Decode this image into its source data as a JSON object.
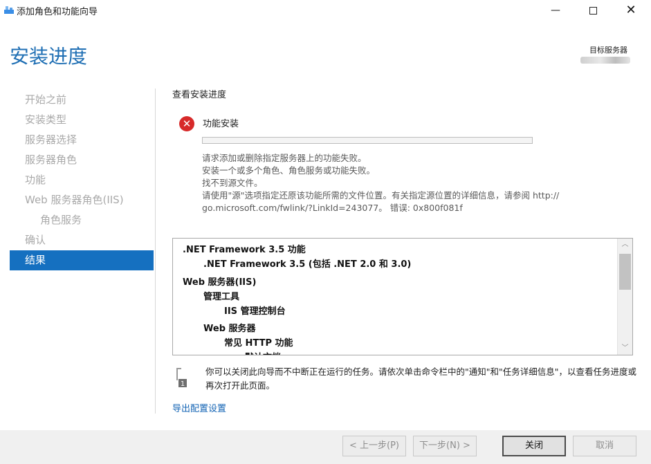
{
  "window": {
    "title": "添加角色和功能向导",
    "minimize_glyph": "—",
    "close_glyph": "✕"
  },
  "header": {
    "heading": "安装进度",
    "destination_label": "目标服务器"
  },
  "nav": {
    "items": [
      {
        "label": "开始之前"
      },
      {
        "label": "安装类型"
      },
      {
        "label": "服务器选择"
      },
      {
        "label": "服务器角色"
      },
      {
        "label": "功能"
      },
      {
        "label": "Web 服务器角色(IIS)"
      },
      {
        "label": "角色服务"
      },
      {
        "label": "确认"
      },
      {
        "label": "结果"
      }
    ],
    "active_index": 8
  },
  "main": {
    "section_title": "查看安装进度",
    "feature_name": "功能安装",
    "progress_percent": 0,
    "messages": [
      "请求添加或删除指定服务器上的功能失败。",
      "安装一个或多个角色、角色服务或功能失败。",
      "找不到源文件。",
      "请使用\"源\"选项指定还原该功能所需的文件位置。有关指定源位置的详细信息，请参阅 http://",
      "go.microsoft.com/fwlink/?LinkId=243077。 错误: 0x800f081f"
    ],
    "list": [
      {
        "text": ".NET Framework 3.5 功能"
      },
      {
        "text": ".NET Framework 3.5 (包括 .NET 2.0 和 3.0)"
      },
      {
        "text": "Web 服务器(IIS)"
      },
      {
        "text": "管理工具"
      },
      {
        "text": "IIS 管理控制台"
      },
      {
        "text": "Web 服务器"
      },
      {
        "text": "常见 HTTP 功能"
      },
      {
        "text": "默认文档"
      }
    ],
    "notice": "你可以关闭此向导而不中断正在运行的任务。请依次单击命令栏中的\"通知\"和\"任务详细信息\"，以查看任务进度或再次打开此页面。",
    "notice_badge": "1",
    "export_link": "导出配置设置"
  },
  "footer": {
    "prev": "< 上一步(P)",
    "next": "下一步(N) >",
    "close": "关闭",
    "cancel": "取消"
  },
  "colors": {
    "accent": "#1570c0",
    "heading": "#1f6fb4",
    "error": "#d72a2a",
    "link": "#1565b5"
  }
}
